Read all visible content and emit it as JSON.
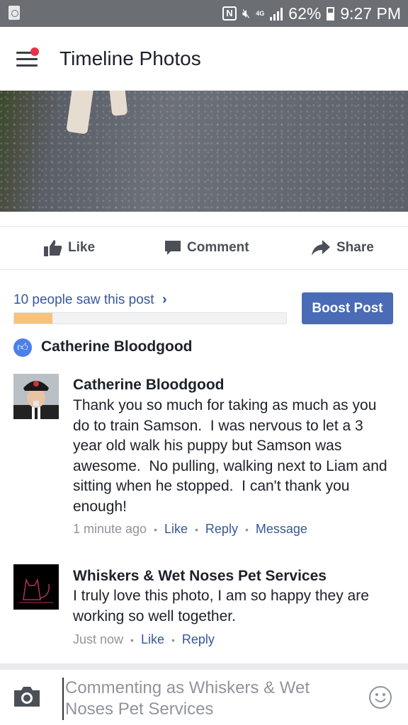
{
  "status_bar": {
    "battery": "62%",
    "time": "9:27 PM",
    "nfc": "N",
    "network": "4G"
  },
  "app_bar": {
    "title": "Timeline Photos"
  },
  "actions": {
    "like": "Like",
    "comment": "Comment",
    "share": "Share"
  },
  "reach": {
    "text": "10 people saw this post",
    "progress": 0.14,
    "boost_label": "Boost Post"
  },
  "liked_by": {
    "name": "Catherine Bloodgood"
  },
  "comments": [
    {
      "author": "Catherine Bloodgood",
      "text": "Thank you so much for taking as much as you do to train Samson.  I was nervous to let a 3 year old walk his puppy but Samson was awesome.  No pulling, walking next to Liam and sitting when he stopped.  I can't thank you enough!",
      "time": "1 minute ago",
      "like": "Like",
      "reply": "Reply",
      "message": "Message"
    },
    {
      "author": "Whiskers & Wet Noses Pet Services",
      "text": "I truly love this photo, I am so happy they are working so well together.",
      "time": "Just now",
      "like": "Like",
      "reply": "Reply"
    }
  ],
  "composer": {
    "placeholder": "Commenting as Whiskers & Wet Noses Pet Services"
  },
  "colors": {
    "link": "#365899",
    "boost": "#4a6bb5",
    "progress": "#f7c27b",
    "status_bar": "#6b6e73"
  }
}
